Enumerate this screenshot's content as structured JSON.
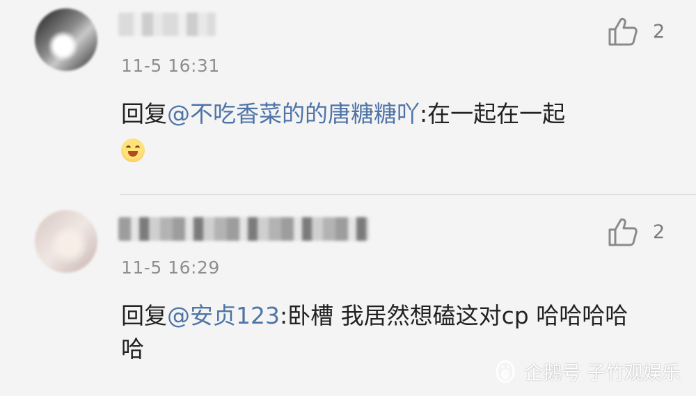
{
  "comments": [
    {
      "timestamp": "11-5 16:31",
      "likes": "2",
      "reply_prefix": "回复",
      "mention": "@不吃香菜的的唐糖糖吖",
      "text": ":在一起在一起",
      "emoji": "smiling-face-emoji"
    },
    {
      "timestamp": "11-5 16:29",
      "likes": "2",
      "reply_prefix": "回复",
      "mention": "@安贞123",
      "text": ":卧槽 我居然想磕这对cp 哈哈哈哈哈"
    }
  ],
  "watermark": {
    "text": "企鹅号 子竹观娱乐",
    "icon": "penguin-icon"
  },
  "colors": {
    "mention": "#4f74a6",
    "timestamp": "#8e8e8e",
    "background": "#f4f4f4"
  }
}
